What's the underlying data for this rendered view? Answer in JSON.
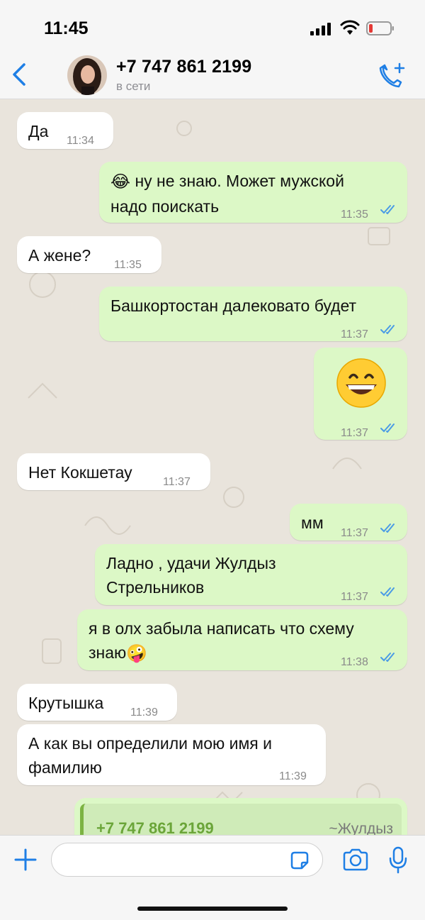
{
  "status_bar": {
    "time": "11:45"
  },
  "header": {
    "contact_name": "+7 747 861 2199",
    "contact_status": "в сети"
  },
  "messages": [
    {
      "dir": "in",
      "text": "Да",
      "time": "11:34"
    },
    {
      "dir": "out",
      "text": "ну не знаю. Может мужской",
      "text2": "надо поискать",
      "time": "11:35",
      "emoji_lead": "😂"
    },
    {
      "dir": "in",
      "text": "А жене?",
      "time": "11:35"
    },
    {
      "dir": "out",
      "text": "Башкортостан далековато будет",
      "time": "11:37"
    },
    {
      "dir": "out",
      "text": "😄",
      "time": "11:37"
    },
    {
      "dir": "in",
      "text": "Нет Кокшетау",
      "time": "11:37"
    },
    {
      "dir": "out",
      "text": "мм",
      "time": "11:37"
    },
    {
      "dir": "out",
      "text": "Ладно , удачи Жулдыз",
      "text2": "Стрельников",
      "time": "11:37"
    },
    {
      "dir": "out",
      "text": "я в олх забыла написать что схему",
      "text2": "знаю",
      "time": "11:38",
      "emoji_trail": "🤪"
    },
    {
      "dir": "in",
      "text": "Крутышка",
      "time": "11:39"
    },
    {
      "dir": "in",
      "text": "А как вы определили мою имя и",
      "text2": "фамилию",
      "time": "11:39"
    },
    {
      "dir": "out",
      "quote_name": "+7 747 861 2199",
      "quote_alias": "~Жулдыз"
    }
  ],
  "input": {
    "placeholder": ""
  },
  "colors": {
    "accent": "#1F7FE5",
    "outgoing": "#DCF8C6",
    "incoming": "#FFFFFF",
    "quote": "#7CB342"
  }
}
